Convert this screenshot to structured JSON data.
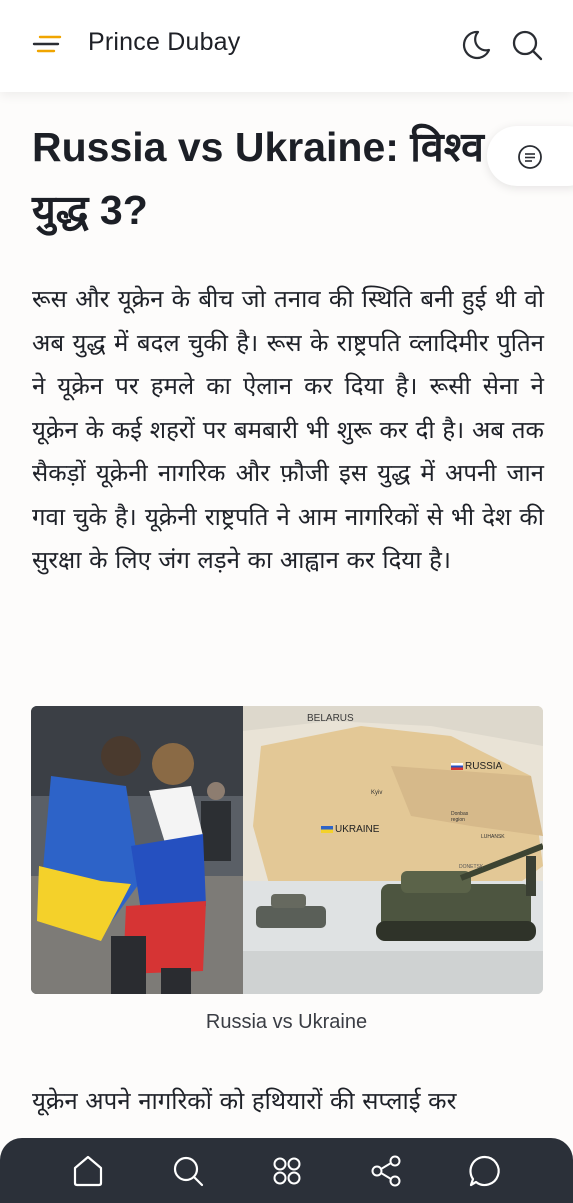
{
  "header": {
    "site_title": "Prince Dubay",
    "icons": [
      "menu-icon",
      "moon-icon",
      "search-icon"
    ]
  },
  "article": {
    "title": "Russia vs Ukraine: विश्व युद्ध 3?",
    "paragraph": "रूस और यूक्रेन के बीच जो तनाव की स्थिति बनी हुई थी वो अब युद्ध में बदल चुकी है। रूस के राष्ट्रपति व्लादिमीर पुतिन ने यूक्रेन पर हमले का ऐलान कर दिया है। रूसी सेना ने यूक्रेन के कई शहरों पर बमबारी भी शुरू कर दी है। अब तक सैकड़ों यूक्रेनी नागरिक और फ़ौजी इस युद्ध में अपनी जान गवा चुके है। यूक्रेनी राष्ट्रपति ने आम नागरिकों से भी देश की सुरक्षा के लिए जंग लड़ने का आह्वान कर दिया है।",
    "figure": {
      "caption": "Russia vs Ukraine",
      "map_labels": {
        "belarus": "BELARUS",
        "russia": "RUSSIA",
        "ukraine": "UKRAINE",
        "kyiv": "Kyiv",
        "donbas": "Donbas region",
        "luhansk": "LUHANSK",
        "donetsk": "DONETSK"
      }
    },
    "paragraph2": "यूक्रेन अपने नागरिकों को हथियारों की सप्लाई कर"
  },
  "bottom_nav": {
    "items": [
      "home-icon",
      "search-icon",
      "apps-icon",
      "share-icon",
      "chat-icon"
    ]
  },
  "colors": {
    "background": "#fdfcfb",
    "header_bg": "#ffffff",
    "bottom_nav_bg": "#2b3039",
    "menu_accent": "#f0a500",
    "text": "#1c1f26"
  }
}
